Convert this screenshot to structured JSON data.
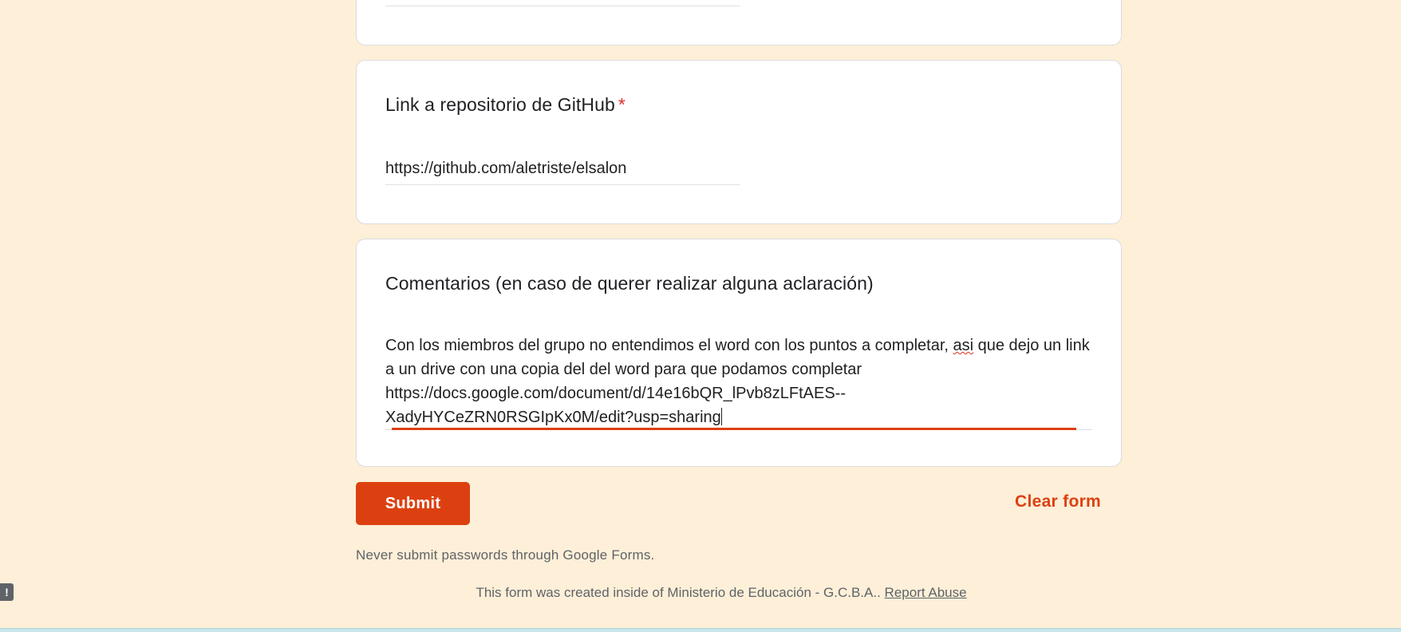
{
  "questions": {
    "github": {
      "title": "Link a repositorio de GitHub",
      "required_marker": "*",
      "answer": "https://github.com/aletriste/elsalon"
    },
    "comments": {
      "title": "Comentarios (en caso de querer realizar alguna aclaración)",
      "answer_part1": "Con los miembros del grupo no entendimos el word con los puntos a completar, ",
      "answer_misspelled": "asi",
      "answer_part2": " que dejo un link a un drive con una copia del del word para que podamos completar\nhttps://docs.google.com/document/d/14e16bQR_lPvb8zLFtAES--\nXadyHYCeZRN0RSGIpKx0M/edit?usp=sharing"
    }
  },
  "actions": {
    "submit_label": "Submit",
    "clear_label": "Clear form"
  },
  "notices": {
    "never_submit": "Never submit passwords through Google Forms.",
    "created_inside": "This form was created inside of Ministerio de Educación - G.C.B.A..",
    "report_abuse": "Report Abuse"
  },
  "feedback": {
    "icon": "exclamation-icon",
    "glyph": "!"
  },
  "colors": {
    "background": "#fdefd8",
    "accent": "#dd4010",
    "required": "#d93025"
  }
}
